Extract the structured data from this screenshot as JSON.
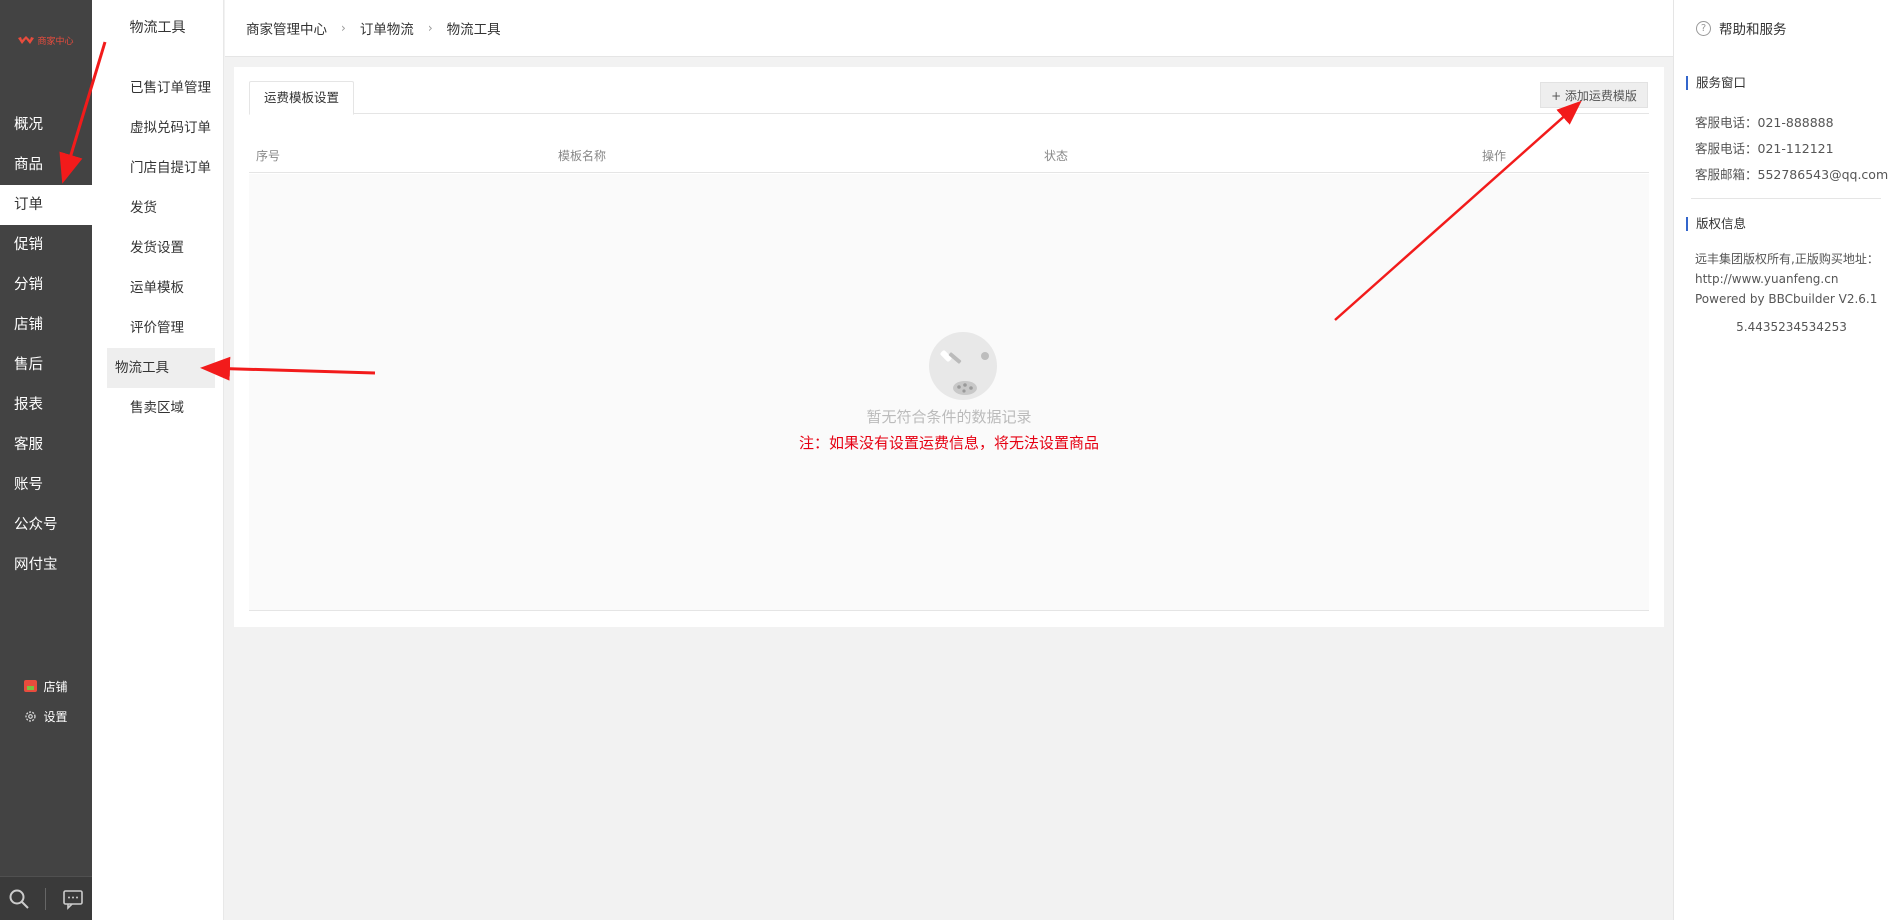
{
  "app": {
    "logo_text": "商家中心"
  },
  "sidebar": {
    "items": [
      {
        "label": "概况"
      },
      {
        "label": "商品"
      },
      {
        "label": "订单",
        "active": true
      },
      {
        "label": "促销"
      },
      {
        "label": "分销"
      },
      {
        "label": "店铺"
      },
      {
        "label": "售后"
      },
      {
        "label": "报表"
      },
      {
        "label": "客服"
      },
      {
        "label": "账号"
      },
      {
        "label": "公众号"
      },
      {
        "label": "网付宝"
      }
    ],
    "shop_label": "店铺",
    "settings_label": "设置"
  },
  "subsidebar": {
    "title": "物流工具",
    "items": [
      {
        "label": "已售订单管理"
      },
      {
        "label": "虚拟兑码订单"
      },
      {
        "label": "门店自提订单"
      },
      {
        "label": "发货"
      },
      {
        "label": "发货设置"
      },
      {
        "label": "运单模板"
      },
      {
        "label": "评价管理"
      },
      {
        "label": "物流工具",
        "active": true
      },
      {
        "label": "售卖区域"
      }
    ]
  },
  "breadcrumb": [
    "商家管理中心",
    "订单物流",
    "物流工具"
  ],
  "main": {
    "tab_label": "运费模板设置",
    "add_button": "+ 添加运费模版",
    "columns": [
      "序号",
      "模板名称",
      "状态",
      "操作"
    ],
    "empty_text": "暂无符合条件的数据记录",
    "note_text": "注：如果没有设置运费信息，将无法设置商品"
  },
  "right_panel": {
    "title": "帮助和服务",
    "service_title": "服务窗口",
    "service_lines": [
      "客服电话：021-888888",
      "客服电话：021-112121",
      "客服邮箱：552786543@qq.com"
    ],
    "copyright_title": "版权信息",
    "copyright_text": "远丰集团版权所有,正版购买地址：http://www.yuanfeng.cn",
    "powered": "Powered by BBCbuilder V2.6.1",
    "version": "5.4435234534253"
  },
  "colors": {
    "sidebar_bg": "#434343",
    "accent_red": "#e60012",
    "annotation_arrow": "#f21b1b"
  }
}
